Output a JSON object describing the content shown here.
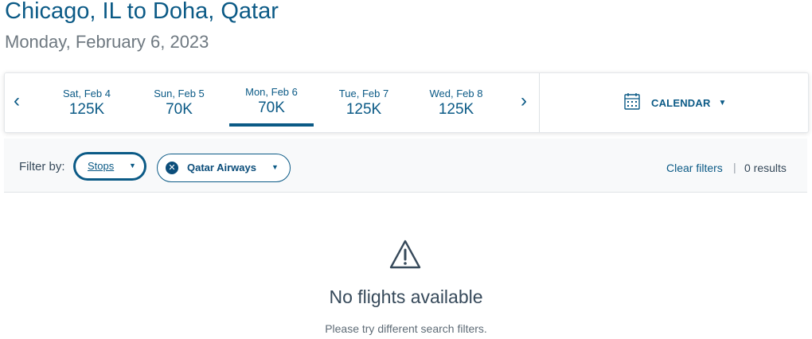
{
  "header": {
    "route": "Chicago, IL to Doha, Qatar",
    "date": "Monday, February 6, 2023"
  },
  "date_bar": {
    "prev_icon": "chevron-left-icon",
    "next_icon": "chevron-right-icon",
    "days": [
      {
        "label": "Sat, Feb 4",
        "price": "125K",
        "selected": false
      },
      {
        "label": "Sun, Feb 5",
        "price": "70K",
        "selected": false
      },
      {
        "label": "Mon, Feb 6",
        "price": "70K",
        "selected": true
      },
      {
        "label": "Tue, Feb 7",
        "price": "125K",
        "selected": false
      },
      {
        "label": "Wed, Feb 8",
        "price": "125K",
        "selected": false
      }
    ],
    "calendar_label": "CALENDAR",
    "calendar_icon": "calendar-icon"
  },
  "filters": {
    "label": "Filter by:",
    "stops_label": "Stops",
    "airline_label": "Qatar Airways",
    "clear_label": "Clear filters",
    "separator": "|",
    "results": "0 results"
  },
  "empty_state": {
    "icon": "warning-icon",
    "title": "No flights available",
    "subtitle": "Please try different search filters."
  },
  "colors": {
    "brand": "#0b5a86",
    "text": "#36495a",
    "muted": "#6e7880"
  }
}
